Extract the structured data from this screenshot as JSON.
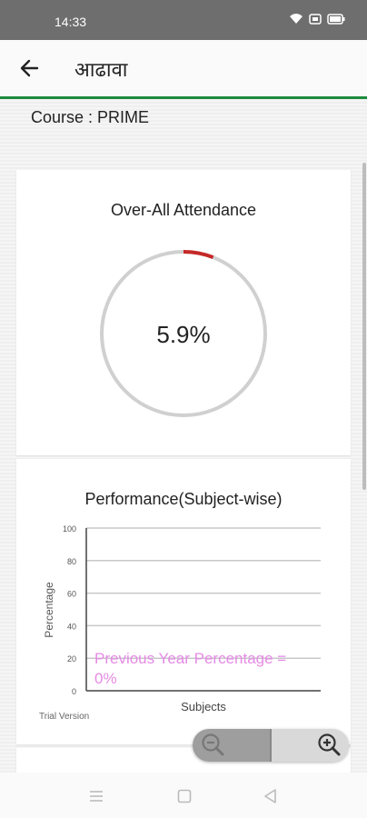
{
  "status_bar": {
    "time": "14:33",
    "icons": [
      "wifi-icon",
      "sim-icon",
      "battery-icon"
    ]
  },
  "app_bar": {
    "back_icon": "arrow-left-icon",
    "title": "आढावा",
    "accent_color": "#1e8a3e"
  },
  "course": {
    "label": "Course : PRIME"
  },
  "attendance": {
    "title": "Over-All Attendance",
    "percent": 5.9,
    "percent_label": "5.9%",
    "ring_color": "#d0d0d0",
    "progress_color": "#c62828"
  },
  "performance": {
    "title": "Performance(Subject-wise)",
    "watermark": "Trial Version",
    "chart_data": {
      "type": "bar",
      "categories": [],
      "series": [],
      "xlabel": "Subjects",
      "ylabel": "Percentage",
      "ylim": [
        0,
        100
      ],
      "yticks": [
        "0",
        "20",
        "40",
        "60",
        "80",
        "100"
      ],
      "grid": true,
      "annotation": "Previous Year Percentage = 0%",
      "annotation_color": "#e58be5"
    }
  },
  "zoom": {
    "zoom_out_icon": "zoom-out-icon",
    "zoom_in_icon": "zoom-in-icon"
  },
  "nav_bar": {
    "icons": [
      "menu-icon",
      "home-icon",
      "back-triangle-icon"
    ]
  }
}
